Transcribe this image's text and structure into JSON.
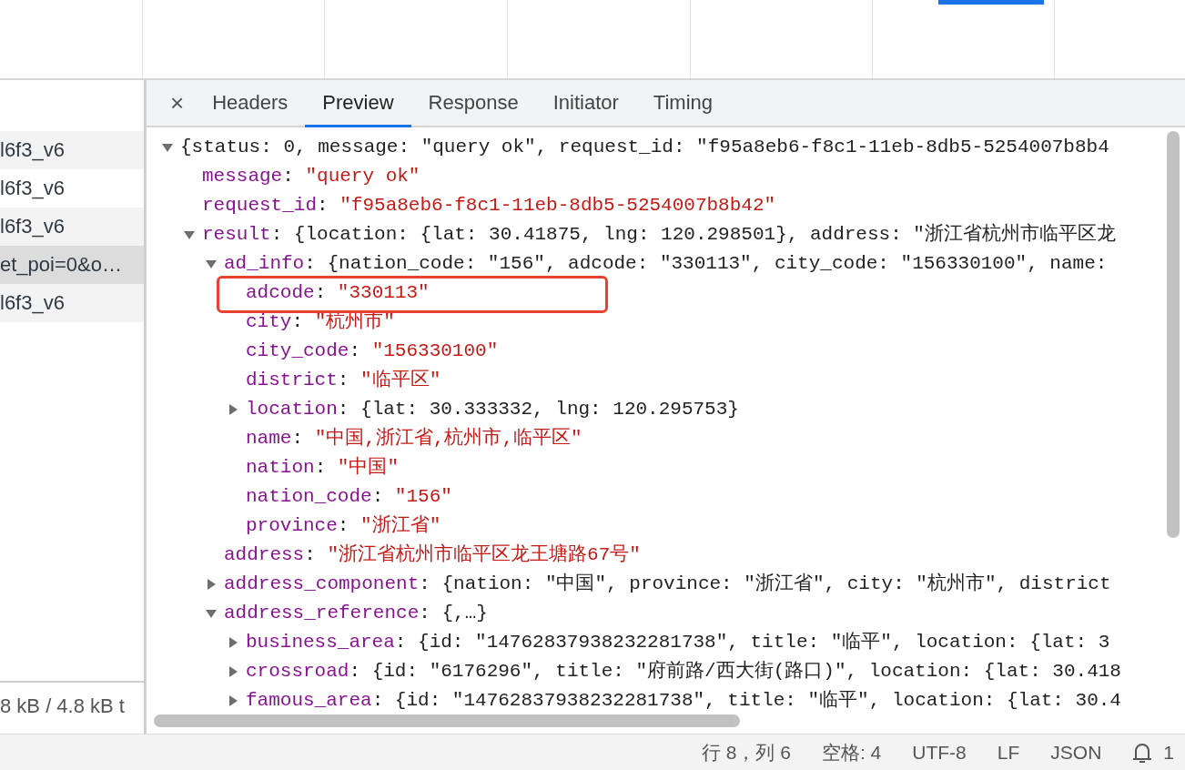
{
  "requests": [
    {
      "name": "l6f3_v6",
      "selected": false
    },
    {
      "name": "l6f3_v6",
      "selected": false
    },
    {
      "name": "l6f3_v6",
      "selected": false
    },
    {
      "name": "et_poi=0&o…",
      "selected": true
    },
    {
      "name": "l6f3_v6",
      "selected": false
    }
  ],
  "transfer_summary": "8 kB / 4.8 kB t",
  "close_label": "×",
  "tabs": [
    {
      "label": "Headers",
      "selected": false
    },
    {
      "label": "Preview",
      "selected": true
    },
    {
      "label": "Response",
      "selected": false
    },
    {
      "label": "Initiator",
      "selected": false
    },
    {
      "label": "Timing",
      "selected": false
    }
  ],
  "tree": [
    {
      "value": "{status: 0, message: \"query ok\", request_id: \"f95a8eb6-f8c1-11eb-8db5-5254007b8b4",
      "kind": "object",
      "expanded": true,
      "children": [
        {
          "key": "message:",
          "value": "\"query ok\"",
          "kind": "string"
        },
        {
          "key": "request_id:",
          "value": "\"f95a8eb6-f8c1-11eb-8db5-5254007b8b42\"",
          "kind": "string"
        },
        {
          "key": "result:",
          "value": "{location: {lat: 30.41875, lng: 120.298501}, address: \"浙江省杭州市临平区龙",
          "kind": "object",
          "expanded": true,
          "children": [
            {
              "key": "ad_info:",
              "value": "{nation_code: \"156\", adcode: \"330113\", city_code: \"156330100\", name:",
              "kind": "object",
              "expanded": true,
              "children": [
                {
                  "key": "adcode:",
                  "value": "\"330113\"",
                  "kind": "string"
                },
                {
                  "key": "city:",
                  "value": "\"杭州市\"",
                  "kind": "string"
                },
                {
                  "key": "city_code:",
                  "value": "\"156330100\"",
                  "kind": "string"
                },
                {
                  "key": "district:",
                  "value": "\"临平区\"",
                  "kind": "string"
                },
                {
                  "key": "location:",
                  "value": "{lat: 30.333332, lng: 120.295753}",
                  "kind": "object",
                  "expanded": false
                },
                {
                  "key": "name:",
                  "value": "\"中国,浙江省,杭州市,临平区\"",
                  "kind": "string"
                },
                {
                  "key": "nation:",
                  "value": "\"中国\"",
                  "kind": "string"
                },
                {
                  "key": "nation_code:",
                  "value": "\"156\"",
                  "kind": "string"
                },
                {
                  "key": "province:",
                  "value": "\"浙江省\"",
                  "kind": "string"
                }
              ]
            },
            {
              "key": "address:",
              "value": "\"浙江省杭州市临平区龙王塘路67号\"",
              "kind": "string"
            },
            {
              "key": "address_component:",
              "value": "{nation: \"中国\", province: \"浙江省\", city: \"杭州市\", district",
              "kind": "object",
              "expanded": false
            },
            {
              "key": "address_reference:",
              "value": "{,…}",
              "kind": "object",
              "expanded": true,
              "children": [
                {
                  "key": "business_area:",
                  "value": "{id: \"14762837938232281738\", title: \"临平\", location: {lat: 3",
                  "kind": "object",
                  "expanded": false
                },
                {
                  "key": "crossroad:",
                  "value": "{id: \"6176296\", title: \"府前路/西大街(路口)\", location: {lat: 30.418",
                  "kind": "object",
                  "expanded": false
                },
                {
                  "key": "famous_area:",
                  "value": "{id: \"14762837938232281738\", title: \"临平\", location: {lat: 30.4",
                  "kind": "object",
                  "expanded": false
                }
              ]
            }
          ]
        }
      ]
    }
  ],
  "status_bar": {
    "items": [
      "行 8，列 6",
      "空格: 4",
      "UTF-8",
      "LF",
      "JSON"
    ],
    "notifications": "1"
  }
}
